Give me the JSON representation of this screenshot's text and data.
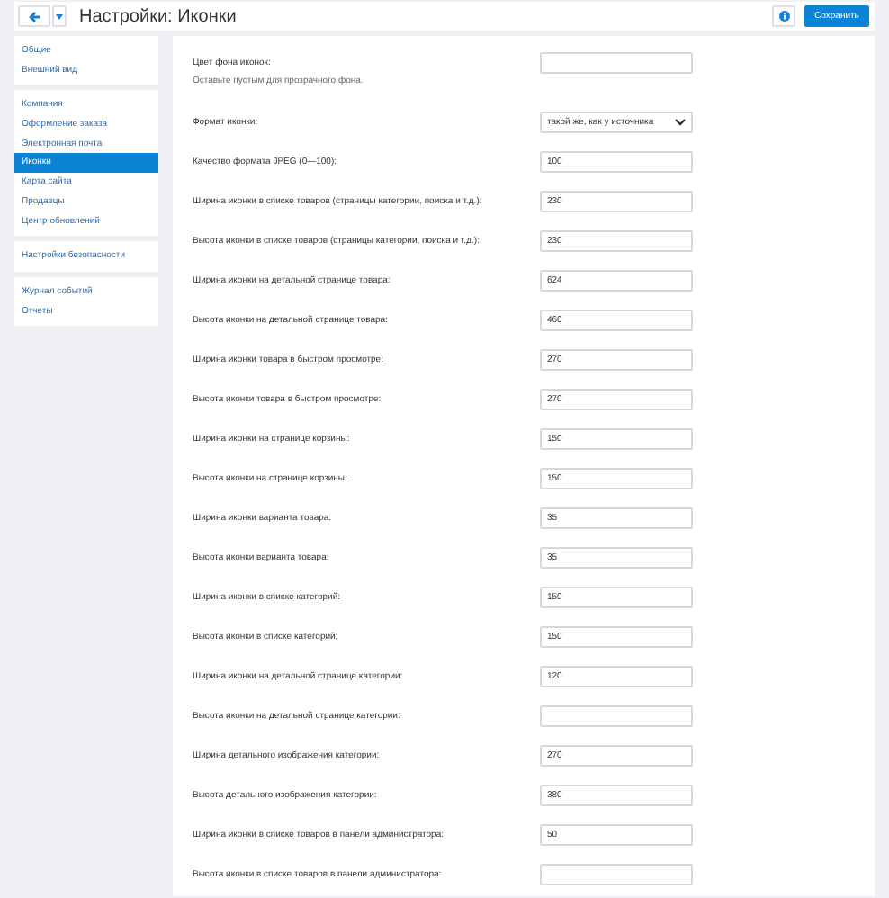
{
  "header": {
    "title": "Настройки: Иконки",
    "save_button": "Сохранить"
  },
  "sidebar": {
    "groups": [
      {
        "items": [
          {
            "label": "Общие",
            "selected": false
          },
          {
            "label": "Внешний вид",
            "selected": false
          }
        ]
      },
      {
        "items": [
          {
            "label": "Компания",
            "selected": false
          },
          {
            "label": "Оформление заказа",
            "selected": false
          },
          {
            "label": "Электронная почта",
            "selected": false
          },
          {
            "label": "Иконки",
            "selected": true
          },
          {
            "label": "Карта сайта",
            "selected": false
          },
          {
            "label": "Продавцы",
            "selected": false
          },
          {
            "label": "Центр обновлений",
            "selected": false
          }
        ]
      },
      {
        "items": [
          {
            "label": "Настройки безопасности",
            "selected": false
          }
        ]
      },
      {
        "items": [
          {
            "label": "Журнал событий",
            "selected": false
          },
          {
            "label": "Отчеты",
            "selected": false
          }
        ]
      }
    ]
  },
  "fields": [
    {
      "kind": "text",
      "label": "Цвет фона иконок:",
      "hint": "Оставьте пустым для прозрачного фона."
    },
    {
      "kind": "select",
      "label": "Формат иконки:",
      "value": "такой же, как у источника"
    },
    {
      "kind": "text",
      "label": "Качество формата JPEG (0—100):",
      "value": "100"
    },
    {
      "kind": "text",
      "label": "Ширина иконки в списке товаров (страницы категории, поиска и т.д.):",
      "value": "230"
    },
    {
      "kind": "text",
      "label": "Высота иконки в списке товаров (страницы категории, поиска и т.д.):",
      "value": "230"
    },
    {
      "kind": "text",
      "label": "Ширина иконки на детальной странице товара:",
      "value": "624"
    },
    {
      "kind": "text",
      "label": "Высота иконки на детальной странице товара:",
      "value": "460"
    },
    {
      "kind": "text",
      "label": "Ширина иконки товара в быстром просмотре:",
      "value": "270"
    },
    {
      "kind": "text",
      "label": "Высота иконки товара в быстром просмотре:",
      "value": "270"
    },
    {
      "kind": "text",
      "label": "Ширина иконки на странице корзины:",
      "value": "150"
    },
    {
      "kind": "text",
      "label": "Высота иконки на странице корзины:",
      "value": "150"
    },
    {
      "kind": "text",
      "label": "Ширина иконки варианта товара:",
      "value": "35"
    },
    {
      "kind": "text",
      "label": "Высота иконки варианта товара:",
      "value": "35"
    },
    {
      "kind": "text",
      "label": "Ширина иконки в списке категорий:",
      "value": "150"
    },
    {
      "kind": "text",
      "label": "Высота иконки в списке категорий:",
      "value": "150"
    },
    {
      "kind": "text",
      "label": "Ширина иконки на детальной странице категории:",
      "value": "120"
    },
    {
      "kind": "text",
      "label": "Высота иконки на детальной странице категории:"
    },
    {
      "kind": "text",
      "label": "Ширина детального изображения категории:",
      "value": "270"
    },
    {
      "kind": "text",
      "label": "Высота детального изображения категории:",
      "value": "380"
    },
    {
      "kind": "text",
      "label": "Ширина иконки в списке товаров в панели администратора:",
      "value": "50"
    },
    {
      "kind": "text",
      "label": "Высота иконки в списке товаров в панели администратора:"
    }
  ]
}
